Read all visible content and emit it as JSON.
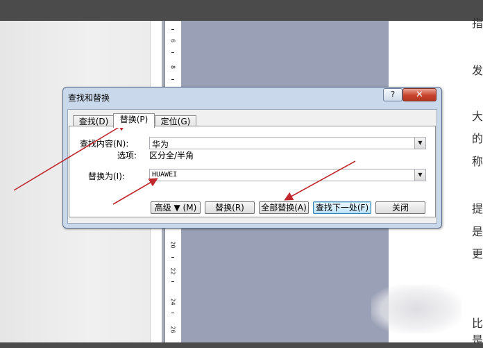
{
  "dialog": {
    "title": "查找和替换",
    "help_label": "?",
    "close_label": "✕",
    "tabs": [
      {
        "label": "查找(D)"
      },
      {
        "label": "替换(P)"
      },
      {
        "label": "定位(G)"
      }
    ],
    "find_label": "查找内容(N):",
    "find_value": "华为",
    "options_label": "选项:",
    "options_value": "区分全/半角",
    "replace_label": "替换为(I):",
    "replace_value": "HUAWEI",
    "buttons": {
      "more": "高级 ▼ (M)",
      "replace": "替换(R)",
      "replace_all": "全部替换(A)",
      "find_next": "查找下一处(F)",
      "close": "关闭"
    }
  },
  "ruler": {
    "numbers": [
      "6",
      "8",
      "20",
      "22",
      "24",
      "26"
    ]
  },
  "document": {
    "right_chars": [
      "指",
      "发",
      "大",
      "的",
      "称",
      "提",
      "是",
      "更",
      "比",
      "是"
    ]
  },
  "colors": {
    "annotation_arrow": "#c0282d",
    "dialog_frame": "#c9d8ea",
    "close_button": "#c8442c",
    "gray_page": "#9aa0b5"
  }
}
